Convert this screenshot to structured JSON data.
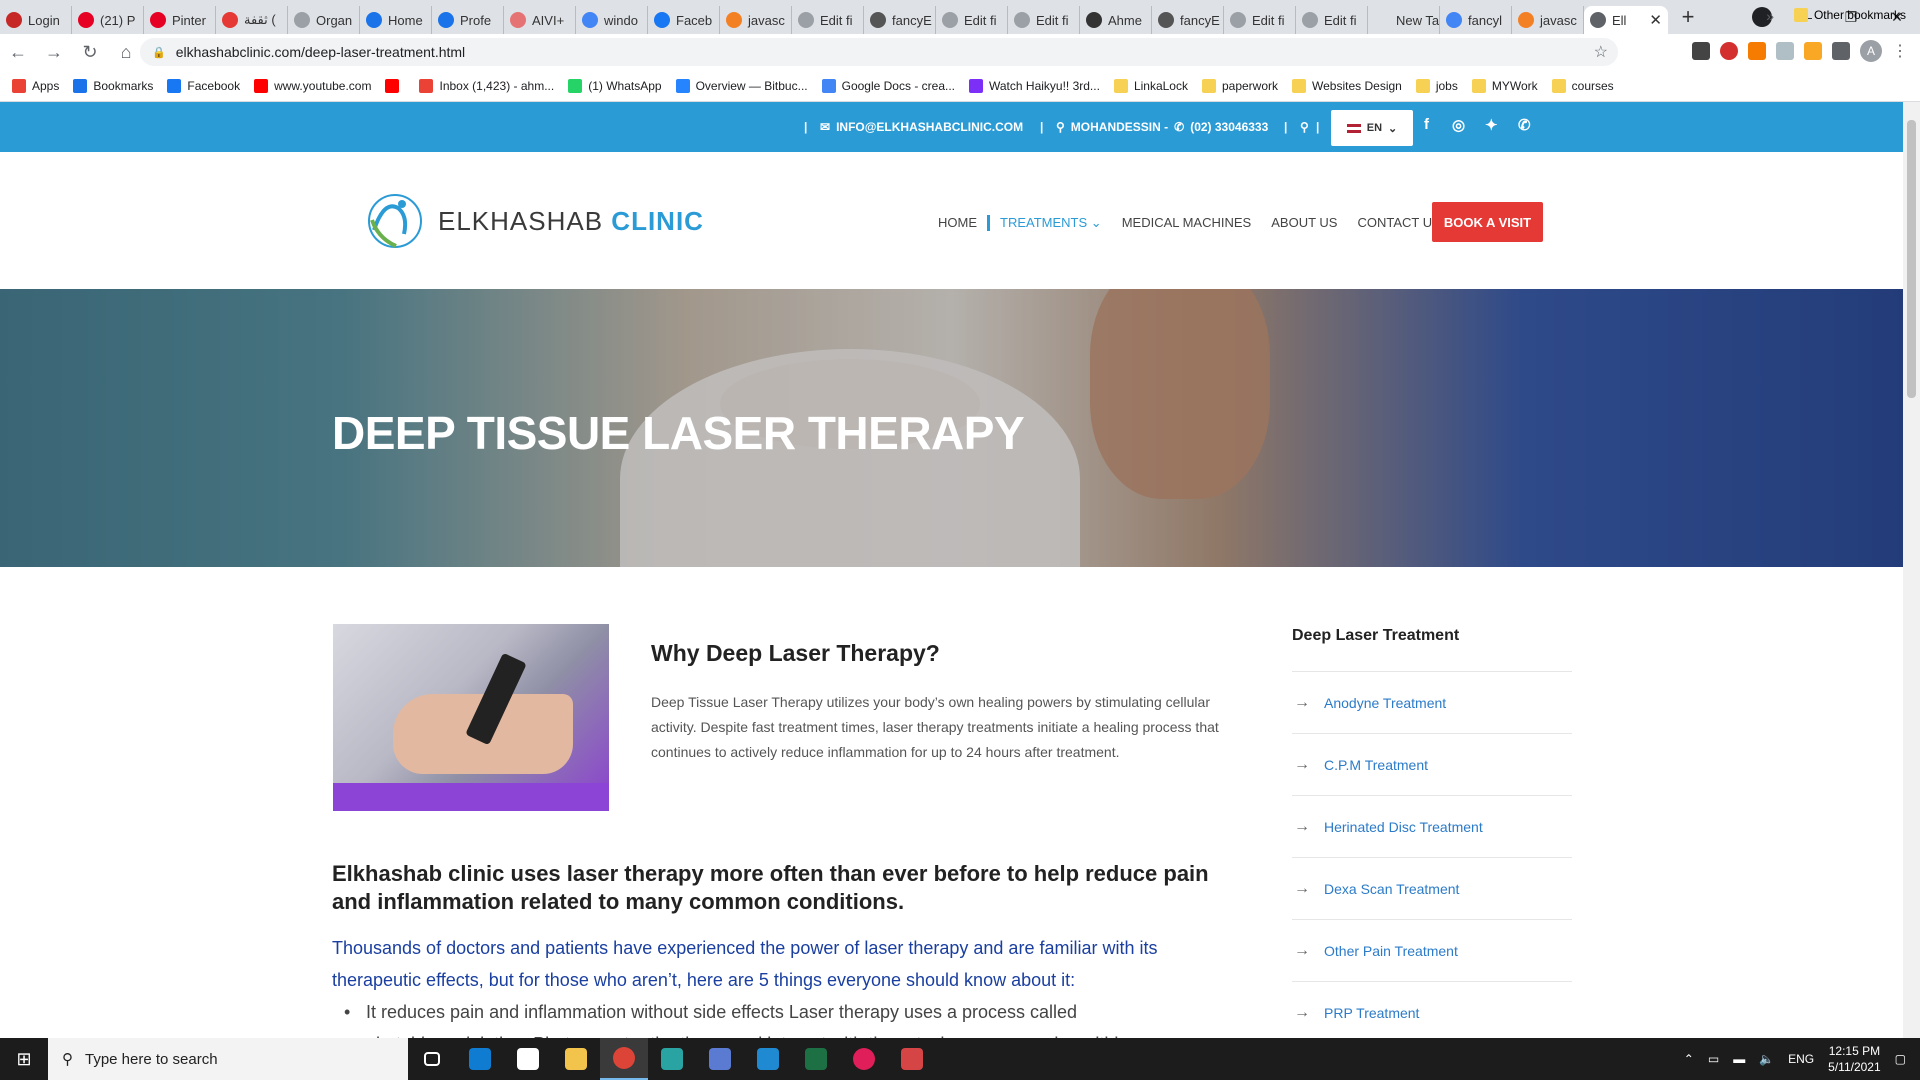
{
  "browser": {
    "tabs": [
      {
        "label": "Login",
        "color": "#c62828"
      },
      {
        "label": "(21) P",
        "color": "#e60023"
      },
      {
        "label": "Pinter",
        "color": "#e60023"
      },
      {
        "label": "ثقفة (",
        "color": "#e53935"
      },
      {
        "label": "Organ",
        "color": "#9aa0a6"
      },
      {
        "label": "Home",
        "color": "#1a73e8"
      },
      {
        "label": "Profe",
        "color": "#1a73e8"
      },
      {
        "label": "AIVI+",
        "color": "#e57373"
      },
      {
        "label": "windo",
        "color": "#4285f4"
      },
      {
        "label": "Faceb",
        "color": "#1877f2"
      },
      {
        "label": "javasc",
        "color": "#f48024"
      },
      {
        "label": "Edit fi",
        "color": "#9aa0a6"
      },
      {
        "label": "fancyE",
        "color": "#555555"
      },
      {
        "label": "Edit fi",
        "color": "#9aa0a6"
      },
      {
        "label": "Edit fi",
        "color": "#9aa0a6"
      },
      {
        "label": "Ahme",
        "color": "#333333"
      },
      {
        "label": "fancyE",
        "color": "#555555"
      },
      {
        "label": "Edit fi",
        "color": "#9aa0a6"
      },
      {
        "label": "Edit fi",
        "color": "#9aa0a6"
      },
      {
        "label": "New Tab",
        "color": "#dee1e6"
      },
      {
        "label": "fancyl",
        "color": "#4285f4"
      },
      {
        "label": "javasc",
        "color": "#f48024"
      }
    ],
    "active_tab": {
      "label": "Ell",
      "close": "✕"
    },
    "new_tab": "+",
    "window_controls": {
      "minimize": "—",
      "maximize": "❐",
      "close": "✕"
    },
    "url": "elkhashabclinic.com/deep-laser-treatment.html",
    "avatar_letter": "A",
    "bookmarks": [
      {
        "label": "Apps",
        "color": "#ea4335"
      },
      {
        "label": "Bookmarks",
        "color": "#1a73e8"
      },
      {
        "label": "Facebook",
        "color": "#1877f2"
      },
      {
        "label": "www.youtube.com",
        "color": "#ff0000"
      },
      {
        "label": "",
        "color": "#ff0000"
      },
      {
        "label": "Inbox (1,423) - ahm...",
        "color": "#ea4335"
      },
      {
        "label": "(1) WhatsApp",
        "color": "#25d366"
      },
      {
        "label": "Overview — Bitbuc...",
        "color": "#2684ff"
      },
      {
        "label": "Google Docs - crea...",
        "color": "#4285f4"
      },
      {
        "label": "Watch Haikyu!! 3rd...",
        "color": "#7b2ff7"
      },
      {
        "label": "LinkaLock",
        "color": "#f7d154"
      },
      {
        "label": "paperwork",
        "color": "#f7d154"
      },
      {
        "label": "Websites Design",
        "color": "#f7d154"
      },
      {
        "label": "jobs",
        "color": "#f7d154"
      },
      {
        "label": "MYWork",
        "color": "#f7d154"
      },
      {
        "label": "courses",
        "color": "#f7d154"
      }
    ],
    "bookmarks_more": "»",
    "other_bookmarks": "Other bookmarks"
  },
  "site": {
    "topbar": {
      "email": "INFO@ELKHASHABCLINIC.COM",
      "location": "MOHANDESSIN -",
      "phone": "(02) 33046333",
      "lang": "EN",
      "separator": "|"
    },
    "logo": {
      "name_plain": "ELKHASHAB ",
      "name_accent": "CLINIC"
    },
    "menu": {
      "home": "HOME",
      "treatments": "TREATMENTS",
      "machines": "MEDICAL MACHINES",
      "about": "ABOUT US",
      "contact": "CONTACT US",
      "book": "BOOK A VISIT"
    },
    "hero_title": "DEEP TISSUE LASER THERAPY",
    "why": {
      "title": "Why Deep Laser Therapy?",
      "text": "Deep Tissue Laser Therapy utilizes your body’s own healing powers by stimulating cellular activity. Despite fast treatment times, laser therapy treatments initiate a healing process that continues to actively reduce inflammation for up to 24 hours after treatment."
    },
    "main_heading": "Elkhashab clinic uses laser therapy more often than ever before to help reduce pain and inflammation related to many common conditions.",
    "main_para": "Thousands of doctors and patients have experienced the power of laser therapy and are familiar with its therapeutic effects, but for those who aren’t, here are 5 things everyone should know about it:",
    "bullet_1": "It reduces pain and inflammation without side effects Laser therapy uses a process called",
    "bullet_1_cont": "photobiomodulation. Photons enter the tissue and interact with the cytochrome c complex within",
    "sidebar": {
      "title": "Deep Laser Treatment",
      "items": [
        "Anodyne Treatment",
        "C.P.M Treatment",
        "Herinated Disc Treatment",
        "Dexa Scan Treatment",
        "Other Pain Treatment",
        "PRP Treatment"
      ]
    },
    "colors": {
      "primary": "#2b9bd6",
      "book": "#e53935",
      "link": "#2b7bc9",
      "para": "#1a3fa0"
    }
  },
  "taskbar": {
    "search_placeholder": "Type here to search",
    "lang": "ENG",
    "time": "12:15 PM",
    "date": "5/11/2021",
    "apps": [
      {
        "name": "task-view",
        "color": "#ffffff"
      },
      {
        "name": "edge",
        "color": "#0f7bd1"
      },
      {
        "name": "store",
        "color": "#ffffff"
      },
      {
        "name": "explorer",
        "color": "#f3c44b"
      },
      {
        "name": "chrome",
        "color": "#db4437"
      },
      {
        "name": "terminal",
        "color": "#2aa3a3"
      },
      {
        "name": "network",
        "color": "#5a7bd1"
      },
      {
        "name": "vscode",
        "color": "#1f8ad2"
      },
      {
        "name": "excel",
        "color": "#1d7044"
      },
      {
        "name": "slack",
        "color": "#e01e5a"
      },
      {
        "name": "app-red",
        "color": "#d64545"
      }
    ]
  }
}
